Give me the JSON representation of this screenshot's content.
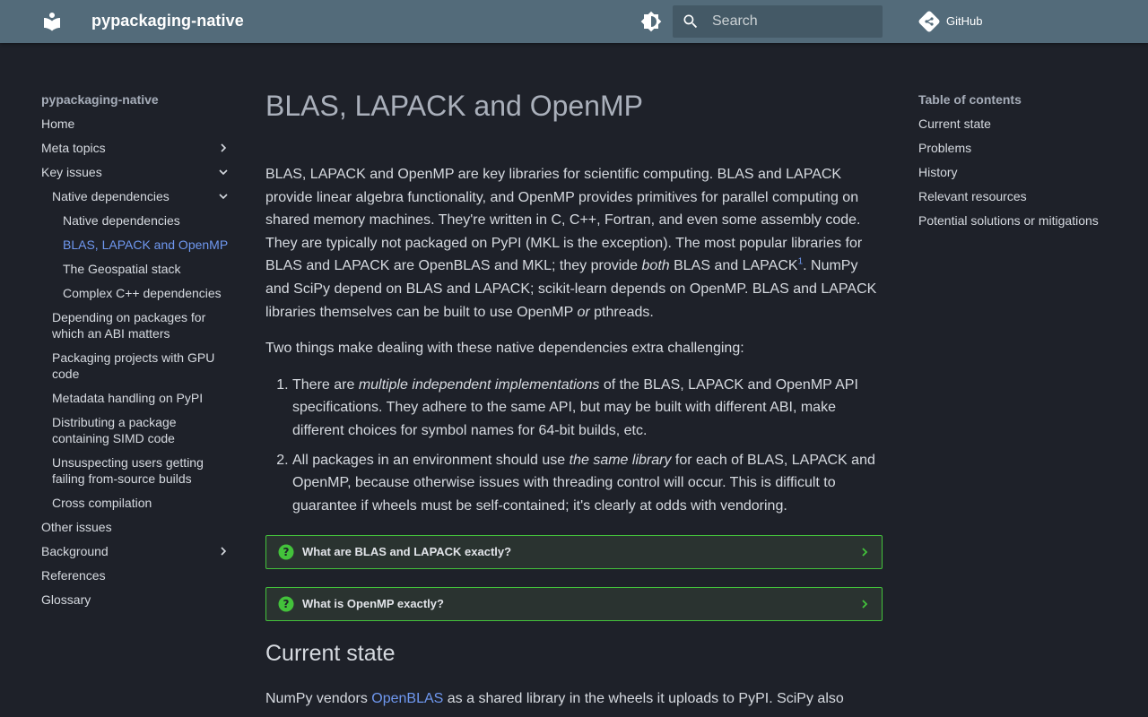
{
  "header": {
    "site_title": "pypackaging-native",
    "search_placeholder": "Search",
    "repo_label": "GitHub",
    "bg_color": "#536b7a"
  },
  "nav": {
    "title": "pypackaging-native",
    "items": [
      {
        "label": "Home"
      },
      {
        "label": "Meta topics",
        "chevron": "chevron-right"
      },
      {
        "label": "Key issues",
        "chevron": "chevron-down"
      },
      {
        "label": "Native dependencies",
        "chevron": "chevron-down"
      },
      {
        "label": "Native dependencies"
      },
      {
        "label": "BLAS, LAPACK and OpenMP",
        "active": true
      },
      {
        "label": "The Geospatial stack"
      },
      {
        "label": "Complex C++ dependencies"
      },
      {
        "label": "Depending on packages for which an ABI matters"
      },
      {
        "label": "Packaging projects with GPU code"
      },
      {
        "label": "Metadata handling on PyPI"
      },
      {
        "label": "Distributing a package containing SIMD code"
      },
      {
        "label": "Unsuspecting users getting failing from-source builds"
      },
      {
        "label": "Cross compilation"
      },
      {
        "label": "Other issues"
      },
      {
        "label": "Background",
        "chevron": "chevron-right"
      },
      {
        "label": "References"
      },
      {
        "label": "Glossary"
      }
    ]
  },
  "content": {
    "title": "BLAS, LAPACK and OpenMP",
    "p1": {
      "a": "BLAS, LAPACK and OpenMP are key libraries for scientific computing. BLAS and LAPACK provide linear algebra functionality, and OpenMP provides primitives for parallel computing on shared memory machines. They're written in C, C++, Fortran, and even some assembly code. They are typically not packaged on PyPI (MKL is the exception). The most popular libraries for BLAS and LAPACK are OpenBLAS and MKL; they provide ",
      "em": "both",
      "b": " BLAS and LAPACK",
      "sup": "1",
      "c": ". NumPy and SciPy depend on BLAS and LAPACK; scikit-learn depends on OpenMP. BLAS and LAPACK libraries themselves can be built to use OpenMP ",
      "em2": "or",
      "d": " pthreads."
    },
    "p2": "Two things make dealing with these native dependencies extra challenging:",
    "list": [
      {
        "a": "There are ",
        "em": "multiple independent implementations",
        "b": " of the BLAS, LAPACK and OpenMP API specifications. They adhere to the same API, but may be built with different ABI, make different choices for symbol names for 64-bit builds, etc."
      },
      {
        "a": "All packages in an environment should use ",
        "em": "the same library",
        "b": " for each of BLAS, LAPACK and OpenMP, because otherwise issues with threading control will occur. This is difficult to guarantee if wheels must be self-contained; it's clearly at odds with vendoring."
      }
    ],
    "admonitions": [
      {
        "title": "What are BLAS and LAPACK exactly?"
      },
      {
        "title": "What is OpenMP exactly?"
      }
    ],
    "h2": "Current state",
    "p3": {
      "a": "NumPy vendors ",
      "link": "OpenBLAS",
      "b": " as a shared library in the wheels it uploads to PyPI. SciPy also"
    }
  },
  "toc": {
    "title": "Table of contents",
    "items": [
      {
        "label": "Current state"
      },
      {
        "label": "Problems"
      },
      {
        "label": "History"
      },
      {
        "label": "Relevant resources"
      },
      {
        "label": "Potential solutions or mitigations"
      }
    ]
  },
  "colors": {
    "background": "#1e2129",
    "accent_link": "#6f98f0",
    "admonition_border": "#43c23b"
  },
  "icons": {
    "logo": "book-logo-icon",
    "theme": "brightness-icon",
    "search": "search-icon",
    "repo": "git-icon",
    "admonition": "question-circle-icon"
  }
}
